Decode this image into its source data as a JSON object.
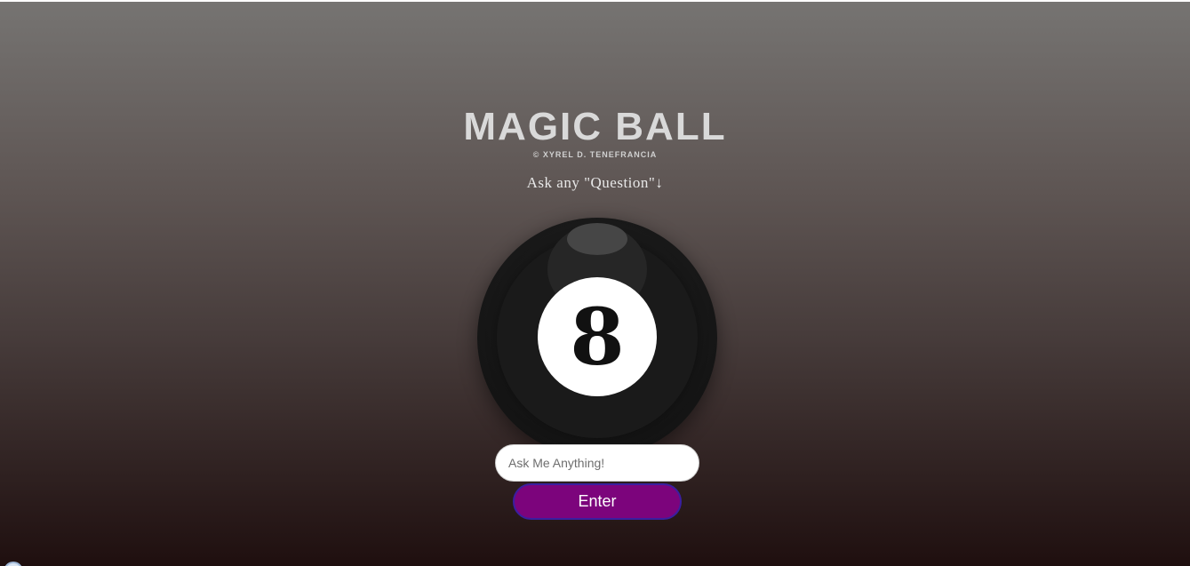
{
  "header": {
    "title": "MAGIC BALL",
    "credit": "© XYREL D. TENEFRANCIA",
    "prompt": "Ask any \"Question\"↓"
  },
  "ball": {
    "number": "8"
  },
  "form": {
    "input_placeholder": "Ask Me Anything!",
    "input_value": "",
    "enter_label": "Enter"
  },
  "colors": {
    "button_background": "#7c047c",
    "button_border": "#3a1fa0",
    "title_text": "#d9d9d9"
  },
  "icons": {
    "corner": "circle-icon"
  }
}
